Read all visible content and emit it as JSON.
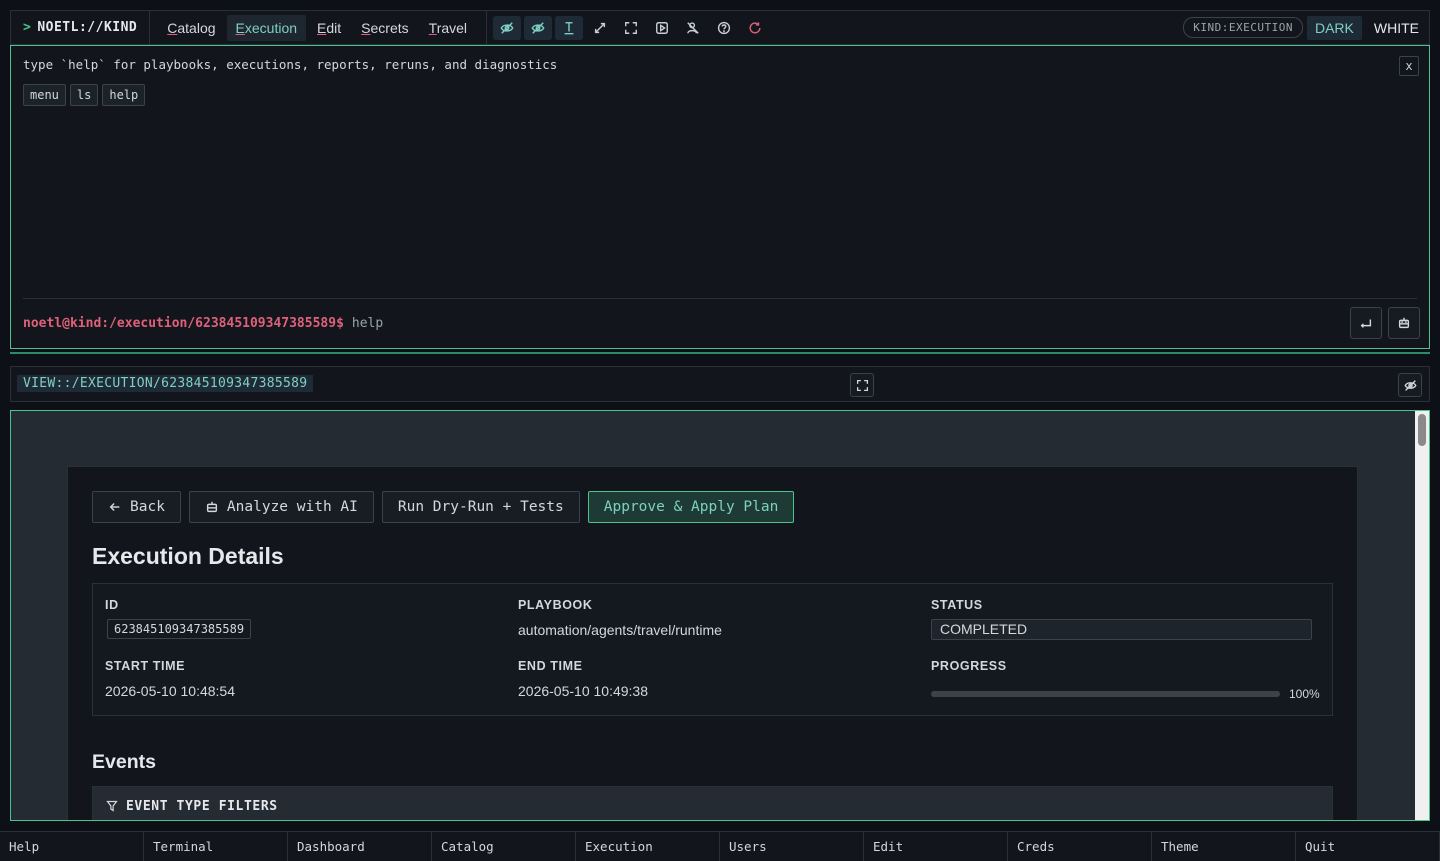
{
  "brand": {
    "caret": ">",
    "title": "NOETL://KIND"
  },
  "menu": [
    {
      "first": "C",
      "rest": "atalog",
      "active": false
    },
    {
      "first": "E",
      "rest": "xecution",
      "active": true
    },
    {
      "first": "E",
      "rest": "dit",
      "active": false
    },
    {
      "first": "S",
      "rest": "ecrets",
      "active": false
    },
    {
      "first": "T",
      "rest": "ravel",
      "active": false
    }
  ],
  "toolbar_icons": [
    "eye-off-icon",
    "eye-off-icon",
    "text-cursor-icon",
    "expand-diagonal-icon",
    "fullscreen-icon",
    "play-box-icon",
    "user-crossed-icon",
    "help-circle-icon",
    "refresh-icon"
  ],
  "top_right": {
    "kind_badge": "KIND:EXECUTION",
    "theme_dark": "DARK",
    "theme_white": "WHITE"
  },
  "terminal": {
    "hint": "type `help` for playbooks, executions, reports, reruns, and diagnostics",
    "close_label": "x",
    "chips": [
      "menu",
      "ls",
      "help"
    ],
    "prompt": "noetl@kind:/execution/623845109347385589$",
    "command": "help"
  },
  "viewbar": {
    "path": "VIEW::/EXECUTION/623845109347385589"
  },
  "actions": {
    "back": "Back",
    "analyze": "Analyze with AI",
    "dry_run": "Run Dry-Run + Tests",
    "approve": "Approve & Apply Plan"
  },
  "execution": {
    "title": "Execution Details",
    "id_label": "ID",
    "id_value": "623845109347385589",
    "playbook_label": "PLAYBOOK",
    "playbook_value": "automation/agents/travel/runtime",
    "status_label": "STATUS",
    "status_value": "COMPLETED",
    "start_label": "START TIME",
    "start_value": "2026-05-10 10:48:54",
    "end_label": "END TIME",
    "end_value": "2026-05-10 10:49:38",
    "progress_label": "PROGRESS",
    "progress_value": 100,
    "progress_text": "100%"
  },
  "events": {
    "title": "Events",
    "filters_label": "EVENT TYPE FILTERS"
  },
  "footer": [
    "Help",
    "Terminal",
    "Dashboard",
    "Catalog",
    "Execution",
    "Users",
    "Edit",
    "Creds",
    "Theme",
    "Quit"
  ],
  "colors": {
    "accent": "#7fd0c0",
    "border_green": "#4cc38a",
    "prompt_pink": "#e0607a",
    "background": "#0d1117"
  }
}
